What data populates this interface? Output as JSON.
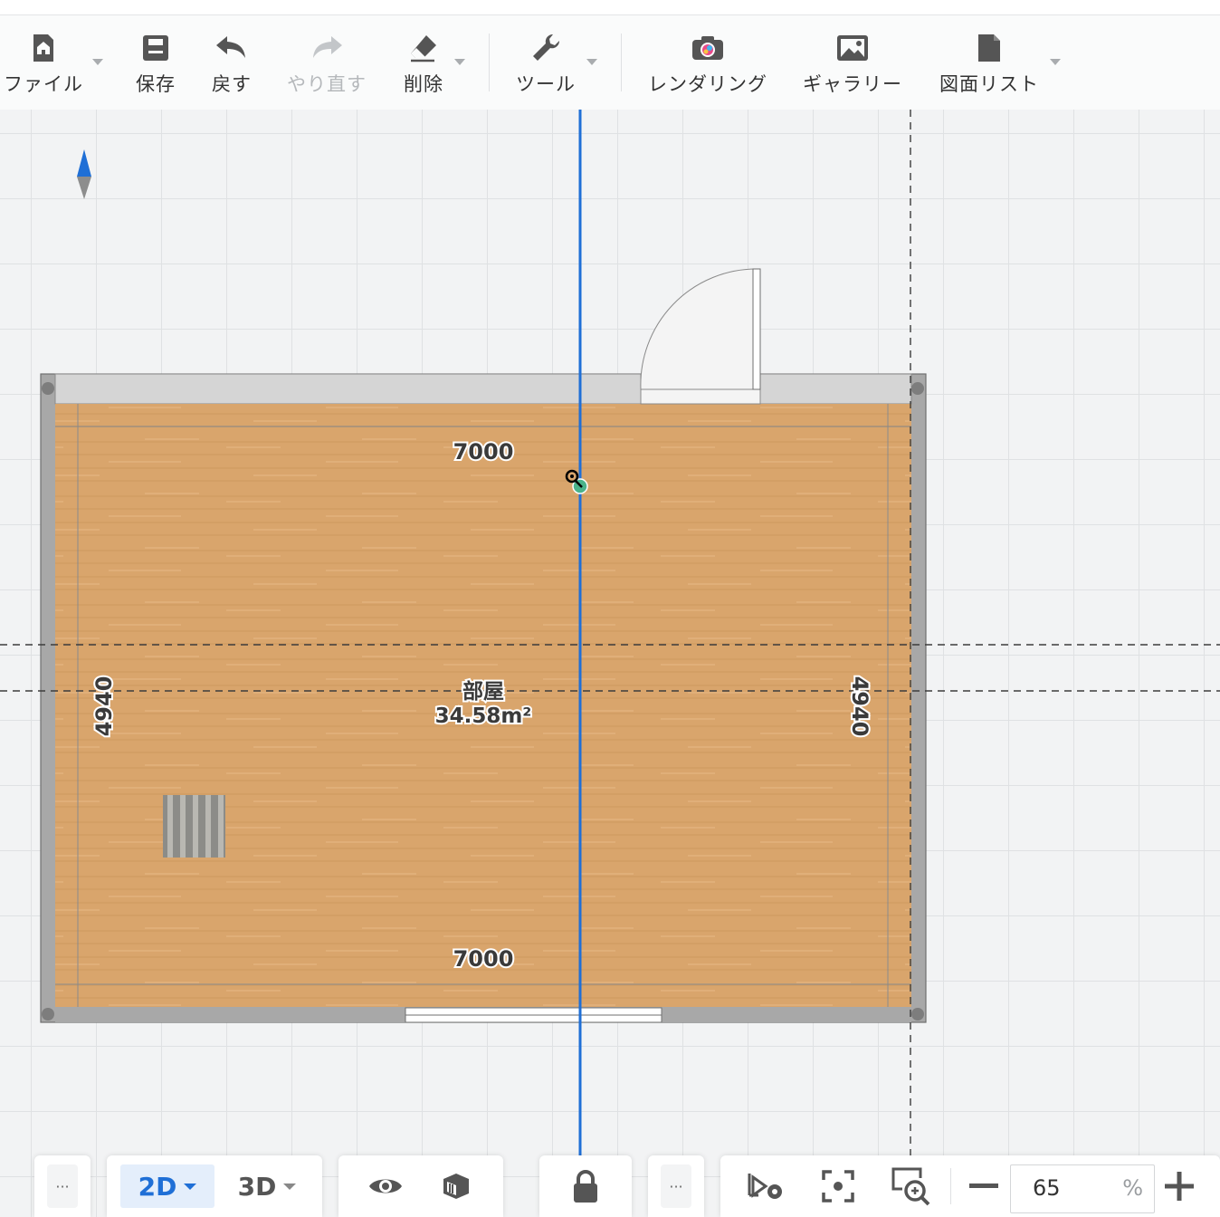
{
  "toolbar": {
    "items": [
      {
        "label": "ファイル",
        "icon": "home-file-icon"
      },
      {
        "label": "保存",
        "icon": "save-icon"
      },
      {
        "label": "戻す",
        "icon": "undo-icon"
      },
      {
        "label": "やり直す",
        "icon": "redo-icon",
        "disabled": true
      },
      {
        "label": "削除",
        "icon": "eraser-icon"
      },
      {
        "label": "ツール",
        "icon": "wrench-icon"
      },
      {
        "label": "レンダリング",
        "icon": "camera-icon"
      },
      {
        "label": "ギャラリー",
        "icon": "gallery-icon"
      },
      {
        "label": "図面リスト",
        "icon": "document-icon"
      }
    ]
  },
  "plan": {
    "top_dimension": "7000",
    "bottom_dimension": "7000",
    "left_dimension": "4940",
    "right_dimension": "4940",
    "room_name": "部屋",
    "room_area": "34.58m²",
    "floor_color": "#d9a56c",
    "wall_color": "#a8a8a8",
    "guide_color": "#1f6fd6"
  },
  "bottombar": {
    "more_left": "···",
    "mode_2d": "2D",
    "mode_3d": "3D",
    "more_mid": "···",
    "zoom_value": "65",
    "zoom_unit": "%",
    "accent_color": "#1f6fd6",
    "selected_mode_bg": "#e4eefb"
  }
}
